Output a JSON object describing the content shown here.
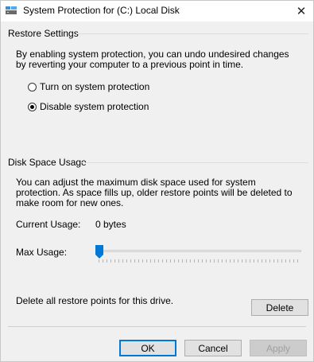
{
  "window": {
    "title": "System Protection for (C:) Local Disk",
    "close_glyph": "✕",
    "icon": "system-protection-icon"
  },
  "restore_settings": {
    "title": "Restore Settings",
    "description": "By enabling system protection, you can undo undesired changes by reverting your computer to a previous point in time.",
    "options": [
      {
        "label": "Turn on system protection",
        "selected": false
      },
      {
        "label": "Disable system protection",
        "selected": true
      }
    ]
  },
  "disk_space": {
    "title": "Disk Space Usage",
    "description": "You can adjust the maximum disk space used for system protection. As space fills up, older restore points will be deleted to make room for new ones.",
    "current_usage_label": "Current Usage:",
    "current_usage_value": "0 bytes",
    "max_usage_label": "Max Usage:",
    "max_usage_fraction": 0,
    "delete_text": "Delete all restore points for this drive.",
    "delete_button": "Delete"
  },
  "buttons": {
    "ok": "OK",
    "cancel": "Cancel",
    "apply": "Apply"
  },
  "colors": {
    "accent": "#0078d7",
    "window_bg": "#f0f0f0"
  }
}
